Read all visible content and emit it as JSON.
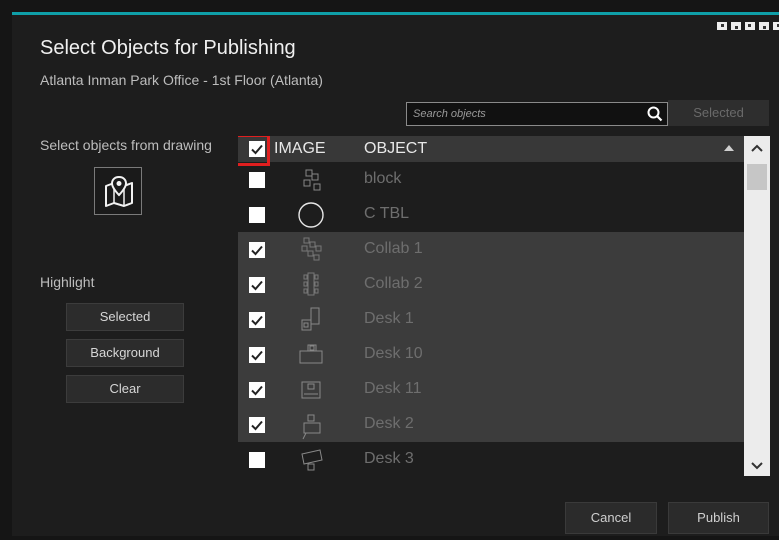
{
  "dialog": {
    "title": "Select Objects for Publishing",
    "subtitle": "Atlanta Inman Park Office - 1st Floor (Atlanta)"
  },
  "search": {
    "placeholder": "Search objects",
    "value": "",
    "icon": "search-icon"
  },
  "selected_toggle": "Selected",
  "left_panel": {
    "select_label": "Select objects from drawing",
    "map_icon": "map-pin-icon",
    "highlight_label": "Highlight",
    "buttons": [
      "Selected",
      "Background",
      "Clear"
    ]
  },
  "table": {
    "header_checked": true,
    "columns": [
      "IMAGE",
      "OBJECT"
    ],
    "rows": [
      {
        "name": "block",
        "checked": false
      },
      {
        "name": "C TBL",
        "checked": false
      },
      {
        "name": "Collab 1",
        "checked": true
      },
      {
        "name": "Collab 2",
        "checked": true
      },
      {
        "name": "Desk 1",
        "checked": true
      },
      {
        "name": "Desk 10",
        "checked": true
      },
      {
        "name": "Desk 11",
        "checked": true
      },
      {
        "name": "Desk 2",
        "checked": true
      },
      {
        "name": "Desk 3",
        "checked": false
      }
    ]
  },
  "footer": {
    "cancel": "Cancel",
    "publish": "Publish"
  },
  "colors": {
    "accent": "#0f9fa8",
    "highlight_frame": "#e01f1f"
  }
}
